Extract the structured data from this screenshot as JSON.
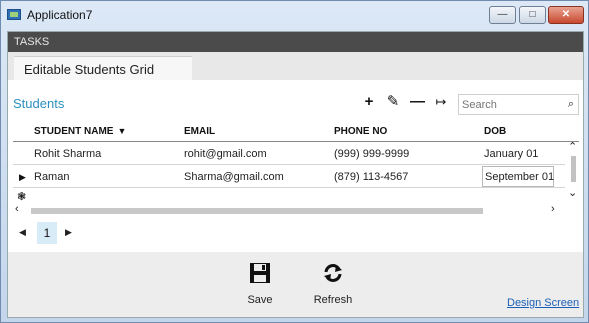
{
  "window": {
    "title": "Application7"
  },
  "tasks": {
    "label": "TASKS"
  },
  "tabs": [
    {
      "label": "Editable Students Grid"
    }
  ],
  "grid": {
    "title": "Students",
    "search_placeholder": "Search",
    "columns": [
      {
        "label": "STUDENT NAME"
      },
      {
        "label": "EMAIL"
      },
      {
        "label": "PHONE NO"
      },
      {
        "label": "DOB"
      }
    ],
    "rows": [
      {
        "name": "Rohit Sharma",
        "email": "rohit@gmail.com",
        "phone": "(999) 999-9999",
        "dob": "January 01"
      },
      {
        "name": "Raman",
        "email": "Sharma@gmail.com",
        "phone": "(879) 113-4567",
        "dob": "September 01"
      }
    ]
  },
  "pager": {
    "current_page": "1"
  },
  "actions": {
    "save_label": "Save",
    "refresh_label": "Refresh"
  },
  "footer": {
    "design_link": "Design Screen"
  }
}
